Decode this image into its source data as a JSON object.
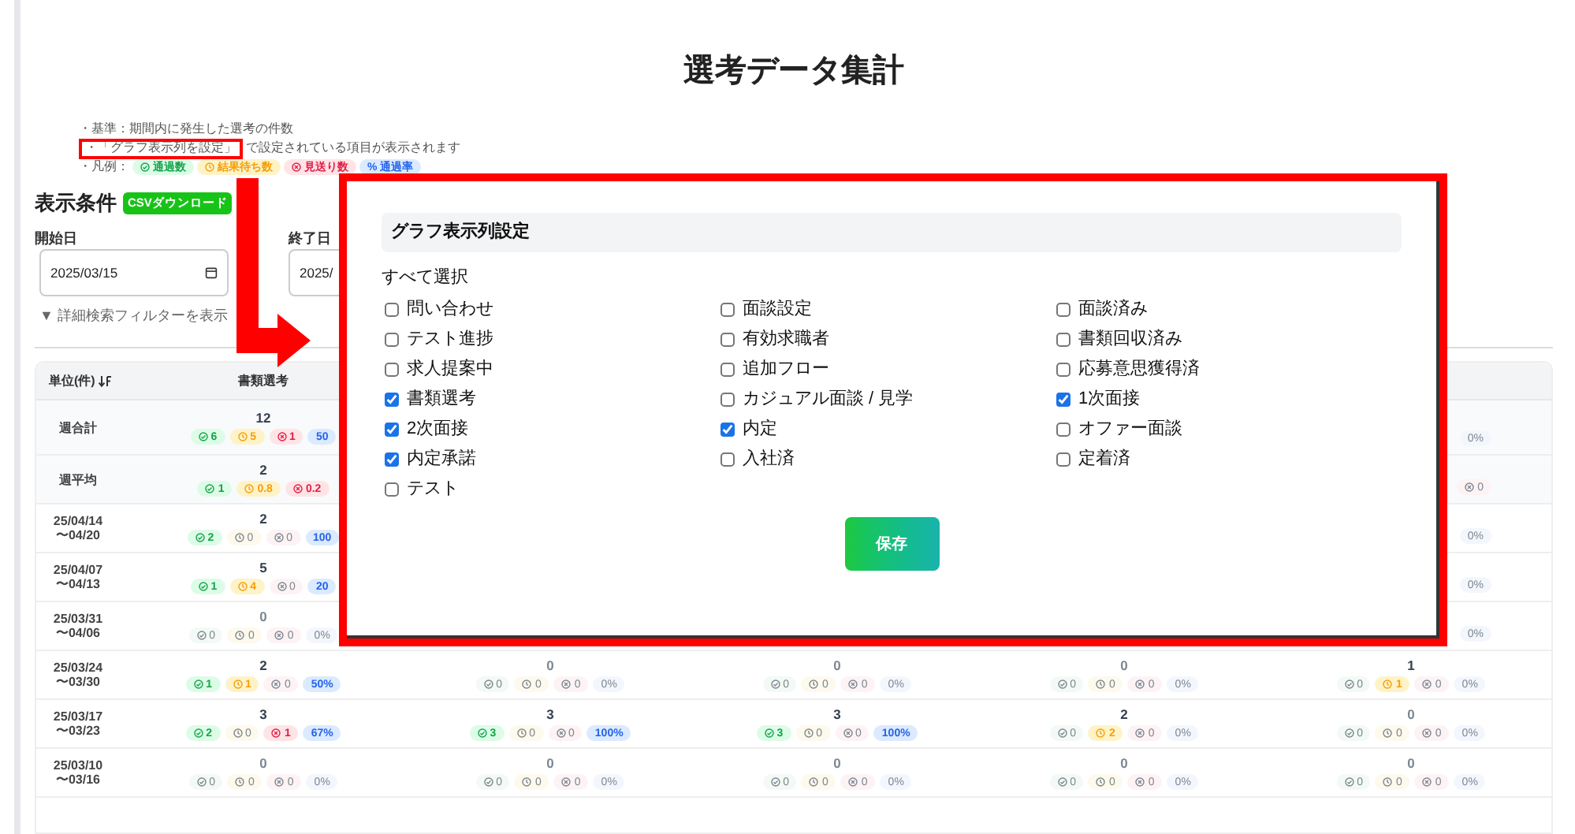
{
  "title": "選考データ集計",
  "notes": [
    {
      "kind": "text",
      "text": "・基準：期間内に発生した選考の件数"
    },
    {
      "kind": "highlight",
      "highlighted": "・「グラフ表示列を設定」",
      "rest": "で設定されている項目が表示されます"
    },
    {
      "kind": "legend",
      "text": "・凡例：",
      "badges": [
        {
          "kind": "pass",
          "text": "通過数",
          "dim": false
        },
        {
          "kind": "wait",
          "text": "結果待ち数",
          "dim": false
        },
        {
          "kind": "reject",
          "text": "見送り数",
          "dim": false
        },
        {
          "kind": "rate",
          "text": "% 通過率",
          "dim": false
        }
      ]
    }
  ],
  "conditions": {
    "title": "表示条件",
    "csv_button": "CSVダウンロード",
    "start_label": "開始日",
    "start_value": "2025/03/15",
    "end_label": "終了日",
    "end_value": "2025/",
    "filter_toggle": "▼ 詳細検索フィルターを表示"
  },
  "table": {
    "unit_header": "単位(件)",
    "columns": [
      "書類選考"
    ],
    "rows": [
      {
        "kind": "summary",
        "label": [
          "週合計"
        ],
        "cells": [
          {
            "total": "12",
            "dim": false,
            "badges": [
              {
                "kind": "pass",
                "text": "6",
                "dim": false
              },
              {
                "kind": "wait",
                "text": "5",
                "dim": false
              },
              {
                "kind": "reject",
                "text": "1",
                "dim": false
              },
              {
                "kind": "rate",
                "text": "50",
                "dim": false
              }
            ]
          },
          null,
          null,
          null,
          {
            "kind": "partial",
            "badges": [
              {
                "kind": "rate",
                "text": "0%",
                "dim": true
              }
            ]
          }
        ]
      },
      {
        "kind": "summary",
        "label": [
          "週平均"
        ],
        "cells": [
          {
            "total": "2",
            "dim": false,
            "badges": [
              {
                "kind": "pass",
                "text": "1",
                "dim": false
              },
              {
                "kind": "wait",
                "text": "0.8",
                "dim": false
              },
              {
                "kind": "reject",
                "text": "0.2",
                "dim": false
              }
            ]
          },
          null,
          null,
          null,
          {
            "kind": "partial",
            "badges": [
              {
                "kind": "reject",
                "text": "0",
                "dim": true
              }
            ]
          }
        ]
      },
      {
        "kind": "week",
        "label": [
          "25/04/14",
          "〜04/20"
        ],
        "cells": [
          {
            "total": "2",
            "dim": false,
            "badges": [
              {
                "kind": "pass",
                "text": "2",
                "dim": false
              },
              {
                "kind": "wait",
                "text": "0",
                "dim": true
              },
              {
                "kind": "reject",
                "text": "0",
                "dim": true
              },
              {
                "kind": "rate",
                "text": "100",
                "dim": false
              }
            ]
          },
          null,
          null,
          null,
          {
            "kind": "partial",
            "badges": [
              {
                "kind": "rate",
                "text": "0%",
                "dim": true
              }
            ]
          }
        ]
      },
      {
        "kind": "week",
        "label": [
          "25/04/07",
          "〜04/13"
        ],
        "cells": [
          {
            "total": "5",
            "dim": false,
            "badges": [
              {
                "kind": "pass",
                "text": "1",
                "dim": false
              },
              {
                "kind": "wait",
                "text": "4",
                "dim": false
              },
              {
                "kind": "reject",
                "text": "0",
                "dim": true
              },
              {
                "kind": "rate",
                "text": "20",
                "dim": false
              }
            ]
          },
          null,
          null,
          null,
          {
            "kind": "partial",
            "badges": [
              {
                "kind": "rate",
                "text": "0%",
                "dim": true
              }
            ]
          }
        ]
      },
      {
        "kind": "week",
        "label": [
          "25/03/31",
          "〜04/06"
        ],
        "cells": [
          {
            "total": "0",
            "dim": true,
            "badges": [
              {
                "kind": "pass",
                "text": "0",
                "dim": true
              },
              {
                "kind": "wait",
                "text": "0",
                "dim": true
              },
              {
                "kind": "reject",
                "text": "0",
                "dim": true
              },
              {
                "kind": "rate",
                "text": "0%",
                "dim": true
              }
            ]
          },
          null,
          null,
          null,
          {
            "kind": "partial",
            "badges": [
              {
                "kind": "rate",
                "text": "0%",
                "dim": true
              }
            ]
          }
        ]
      },
      {
        "kind": "week",
        "label": [
          "25/03/24",
          "〜03/30"
        ],
        "cells": [
          {
            "total": "2",
            "dim": false,
            "badges": [
              {
                "kind": "pass",
                "text": "1",
                "dim": false
              },
              {
                "kind": "wait",
                "text": "1",
                "dim": false
              },
              {
                "kind": "reject",
                "text": "0",
                "dim": true
              },
              {
                "kind": "rate",
                "text": "50%",
                "dim": false
              }
            ]
          },
          {
            "total": "0",
            "dim": true,
            "badges": [
              {
                "kind": "pass",
                "text": "0",
                "dim": true
              },
              {
                "kind": "wait",
                "text": "0",
                "dim": true
              },
              {
                "kind": "reject",
                "text": "0",
                "dim": true
              },
              {
                "kind": "rate",
                "text": "0%",
                "dim": true
              }
            ]
          },
          {
            "total": "0",
            "dim": true,
            "badges": [
              {
                "kind": "pass",
                "text": "0",
                "dim": true
              },
              {
                "kind": "wait",
                "text": "0",
                "dim": true
              },
              {
                "kind": "reject",
                "text": "0",
                "dim": true
              },
              {
                "kind": "rate",
                "text": "0%",
                "dim": true
              }
            ]
          },
          {
            "total": "0",
            "dim": true,
            "badges": [
              {
                "kind": "pass",
                "text": "0",
                "dim": true
              },
              {
                "kind": "wait",
                "text": "0",
                "dim": true
              },
              {
                "kind": "reject",
                "text": "0",
                "dim": true
              },
              {
                "kind": "rate",
                "text": "0%",
                "dim": true
              }
            ]
          },
          {
            "total": "1",
            "dim": false,
            "badges": [
              {
                "kind": "pass",
                "text": "0",
                "dim": true
              },
              {
                "kind": "wait",
                "text": "1",
                "dim": false
              },
              {
                "kind": "reject",
                "text": "0",
                "dim": true
              },
              {
                "kind": "rate",
                "text": "0%",
                "dim": true
              }
            ]
          }
        ]
      },
      {
        "kind": "week",
        "label": [
          "25/03/17",
          "〜03/23"
        ],
        "cells": [
          {
            "total": "3",
            "dim": false,
            "badges": [
              {
                "kind": "pass",
                "text": "2",
                "dim": false
              },
              {
                "kind": "wait",
                "text": "0",
                "dim": true
              },
              {
                "kind": "reject",
                "text": "1",
                "dim": false
              },
              {
                "kind": "rate",
                "text": "67%",
                "dim": false
              }
            ]
          },
          {
            "total": "3",
            "dim": false,
            "badges": [
              {
                "kind": "pass",
                "text": "3",
                "dim": false
              },
              {
                "kind": "wait",
                "text": "0",
                "dim": true
              },
              {
                "kind": "reject",
                "text": "0",
                "dim": true
              },
              {
                "kind": "rate",
                "text": "100%",
                "dim": false
              }
            ]
          },
          {
            "total": "3",
            "dim": false,
            "badges": [
              {
                "kind": "pass",
                "text": "3",
                "dim": false
              },
              {
                "kind": "wait",
                "text": "0",
                "dim": true
              },
              {
                "kind": "reject",
                "text": "0",
                "dim": true
              },
              {
                "kind": "rate",
                "text": "100%",
                "dim": false
              }
            ]
          },
          {
            "total": "2",
            "dim": false,
            "badges": [
              {
                "kind": "pass",
                "text": "0",
                "dim": true
              },
              {
                "kind": "wait",
                "text": "2",
                "dim": false
              },
              {
                "kind": "reject",
                "text": "0",
                "dim": true
              },
              {
                "kind": "rate",
                "text": "0%",
                "dim": true
              }
            ]
          },
          {
            "total": "0",
            "dim": true,
            "badges": [
              {
                "kind": "pass",
                "text": "0",
                "dim": true
              },
              {
                "kind": "wait",
                "text": "0",
                "dim": true
              },
              {
                "kind": "reject",
                "text": "0",
                "dim": true
              },
              {
                "kind": "rate",
                "text": "0%",
                "dim": true
              }
            ]
          }
        ]
      },
      {
        "kind": "week",
        "label": [
          "25/03/10",
          "〜03/16"
        ],
        "cells": [
          {
            "total": "0",
            "dim": true,
            "badges": [
              {
                "kind": "pass",
                "text": "0",
                "dim": true
              },
              {
                "kind": "wait",
                "text": "0",
                "dim": true
              },
              {
                "kind": "reject",
                "text": "0",
                "dim": true
              },
              {
                "kind": "rate",
                "text": "0%",
                "dim": true
              }
            ]
          },
          {
            "total": "0",
            "dim": true,
            "badges": [
              {
                "kind": "pass",
                "text": "0",
                "dim": true
              },
              {
                "kind": "wait",
                "text": "0",
                "dim": true
              },
              {
                "kind": "reject",
                "text": "0",
                "dim": true
              },
              {
                "kind": "rate",
                "text": "0%",
                "dim": true
              }
            ]
          },
          {
            "total": "0",
            "dim": true,
            "badges": [
              {
                "kind": "pass",
                "text": "0",
                "dim": true
              },
              {
                "kind": "wait",
                "text": "0",
                "dim": true
              },
              {
                "kind": "reject",
                "text": "0",
                "dim": true
              },
              {
                "kind": "rate",
                "text": "0%",
                "dim": true
              }
            ]
          },
          {
            "total": "0",
            "dim": true,
            "badges": [
              {
                "kind": "pass",
                "text": "0",
                "dim": true
              },
              {
                "kind": "wait",
                "text": "0",
                "dim": true
              },
              {
                "kind": "reject",
                "text": "0",
                "dim": true
              },
              {
                "kind": "rate",
                "text": "0%",
                "dim": true
              }
            ]
          },
          {
            "total": "0",
            "dim": true,
            "badges": [
              {
                "kind": "pass",
                "text": "0",
                "dim": true
              },
              {
                "kind": "wait",
                "text": "0",
                "dim": true
              },
              {
                "kind": "reject",
                "text": "0",
                "dim": true
              },
              {
                "kind": "rate",
                "text": "0%",
                "dim": true
              }
            ]
          }
        ]
      }
    ]
  },
  "dialog": {
    "title": "グラフ表示列設定",
    "select_all": "すべて選択",
    "save_button": "保存",
    "options": [
      {
        "label": "問い合わせ",
        "checked": false
      },
      {
        "label": "面談設定",
        "checked": false
      },
      {
        "label": "面談済み",
        "checked": false
      },
      {
        "label": "テスト進捗",
        "checked": false
      },
      {
        "label": "有効求職者",
        "checked": false
      },
      {
        "label": "書類回収済み",
        "checked": false
      },
      {
        "label": "求人提案中",
        "checked": false
      },
      {
        "label": "追加フロー",
        "checked": false
      },
      {
        "label": "応募意思獲得済",
        "checked": false
      },
      {
        "label": "書類選考",
        "checked": true
      },
      {
        "label": "カジュアル面談 / 見学",
        "checked": false
      },
      {
        "label": "1次面接",
        "checked": true
      },
      {
        "label": "2次面接",
        "checked": true
      },
      {
        "label": "内定",
        "checked": true
      },
      {
        "label": "オファー面談",
        "checked": false
      },
      {
        "label": "内定承諾",
        "checked": true
      },
      {
        "label": "入社済",
        "checked": false
      },
      {
        "label": "定着済",
        "checked": false
      },
      {
        "label": "テスト",
        "checked": false
      }
    ]
  }
}
